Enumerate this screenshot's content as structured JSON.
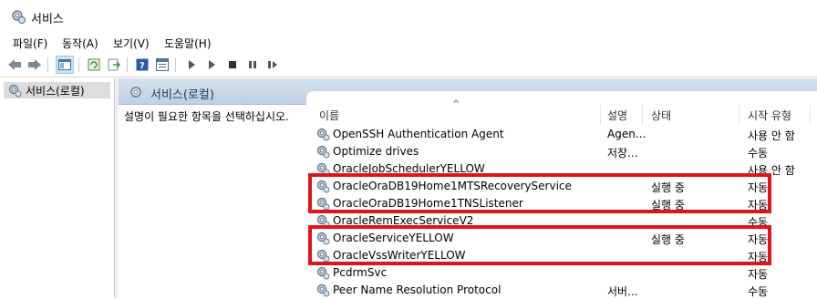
{
  "window": {
    "title": "서비스"
  },
  "menu": [
    "파일(F)",
    "동작(A)",
    "보기(V)",
    "도움말(H)"
  ],
  "toolbar_icons": [
    "back-icon",
    "forward-icon",
    "console-tree-icon",
    "refresh-icon",
    "export-icon",
    "help-icon",
    "properties-icon",
    "play-icon",
    "play-alt-icon",
    "stop-icon",
    "pause-icon",
    "restart-icon"
  ],
  "tree": {
    "item": "서비스(로컬)"
  },
  "panel": {
    "header": "서비스(로컬)",
    "description_prompt": "설명이 필요한 항목을 선택하십시오."
  },
  "columns": {
    "name": "이름",
    "desc": "설명",
    "status": "상태",
    "startup": "시작 유형"
  },
  "services": [
    {
      "name": "OpenSSH Authentication Agent",
      "desc": "Agen...",
      "status": "",
      "startup": "사용 안 함"
    },
    {
      "name": "Optimize drives",
      "desc": "저장...",
      "status": "",
      "startup": "수동"
    },
    {
      "name": "OracleJobSchedulerYELLOW",
      "desc": "",
      "status": "",
      "startup": "사용 안 함"
    },
    {
      "name": "OracleOraDB19Home1MTSRecoveryService",
      "desc": "",
      "status": "실행 중",
      "startup": "자동"
    },
    {
      "name": "OracleOraDB19Home1TNSListener",
      "desc": "",
      "status": "실행 중",
      "startup": "자동"
    },
    {
      "name": "OracleRemExecServiceV2",
      "desc": "",
      "status": "",
      "startup": "수동"
    },
    {
      "name": "OracleServiceYELLOW",
      "desc": "",
      "status": "실행 중",
      "startup": "자동"
    },
    {
      "name": "OracleVssWriterYELLOW",
      "desc": "",
      "status": "",
      "startup": "자동"
    },
    {
      "name": "PcdrmSvc",
      "desc": "",
      "status": "",
      "startup": "자동"
    },
    {
      "name": "Peer Name Resolution Protocol",
      "desc": "서버...",
      "status": "",
      "startup": "수동"
    }
  ],
  "colors": {
    "highlight_box": "#e2131b",
    "header_text": "#1e395b",
    "selection_bg": "#dcdcdc"
  }
}
